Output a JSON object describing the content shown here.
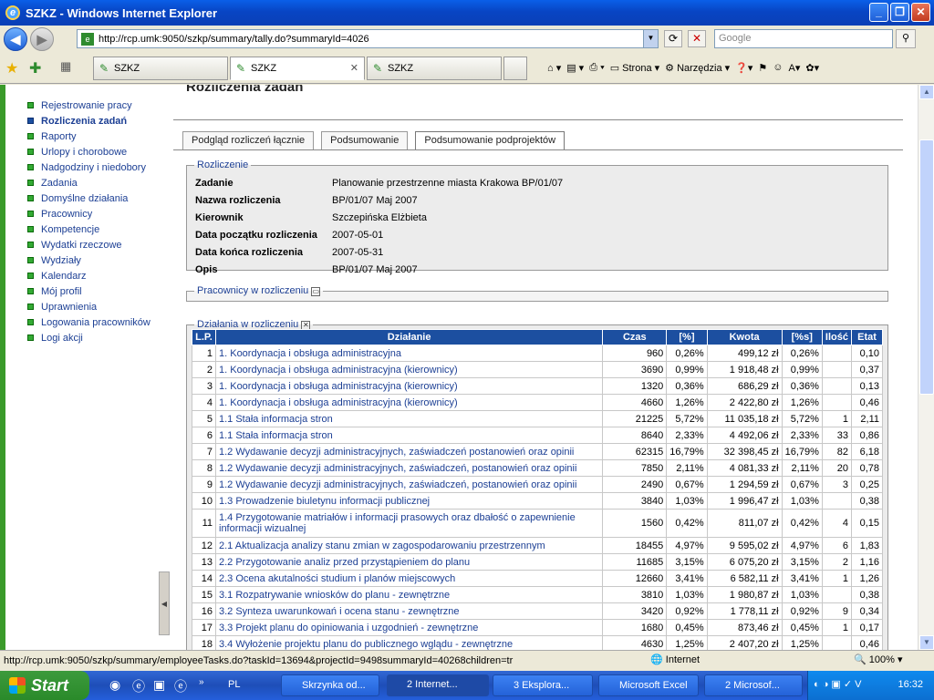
{
  "window": {
    "title": "SZKZ - Windows Internet Explorer"
  },
  "address": {
    "url": "http://rcp.umk:9050/szkp/summary/tally.do?summaryId=4026"
  },
  "search": {
    "placeholder": "Google"
  },
  "browser_tabs": [
    {
      "label": "SZKZ"
    },
    {
      "label": "SZKZ"
    },
    {
      "label": "SZKZ"
    }
  ],
  "toolbar": {
    "page_label": "Strona",
    "tools_label": "Narzędzia"
  },
  "sidebar": {
    "items": [
      {
        "label": "Rejestrowanie pracy"
      },
      {
        "label": "Rozliczenia zadań"
      },
      {
        "label": "Raporty"
      },
      {
        "label": "Urlopy i chorobowe"
      },
      {
        "label": "Nadgodziny i niedobory"
      },
      {
        "label": "Zadania"
      },
      {
        "label": "Domyślne działania"
      },
      {
        "label": "Pracownicy"
      },
      {
        "label": "Kompetencje"
      },
      {
        "label": "Wydatki rzeczowe"
      },
      {
        "label": "Wydziały"
      },
      {
        "label": "Kalendarz"
      },
      {
        "label": "Mój profil"
      },
      {
        "label": "Uprawnienia"
      },
      {
        "label": "Logowania pracowników"
      },
      {
        "label": "Logi akcji"
      }
    ]
  },
  "main": {
    "title": "Rozliczenia zadań",
    "tabs": [
      {
        "label": "Podgląd rozliczeń łącznie"
      },
      {
        "label": "Podsumowanie"
      },
      {
        "label": "Podsumowanie podprojektów"
      }
    ],
    "rozliczenie": {
      "legend": "Rozliczenie",
      "rows": [
        {
          "key": "Zadanie",
          "value": "Planowanie przestrzenne miasta Krakowa BP/01/07"
        },
        {
          "key": "Nazwa rozliczenia",
          "value": "BP/01/07 Maj 2007"
        },
        {
          "key": "Kierownik",
          "value": "Szczepińska Elżbieta"
        },
        {
          "key": "Data początku rozliczenia",
          "value": "2007-05-01"
        },
        {
          "key": "Data końca rozliczenia",
          "value": "2007-05-31"
        },
        {
          "key": "Opis",
          "value": "BP/01/07 Maj 2007"
        }
      ]
    },
    "pracownicy_legend": "Pracownicy w rozliczeniu",
    "dzialania_legend": "Działania w rozliczeniu",
    "table": {
      "headers": [
        "L.P.",
        "Działanie",
        "Czas",
        "[%]",
        "Kwota",
        "[%s]",
        "Ilość",
        "Etat"
      ],
      "rows": [
        [
          "1",
          "1. Koordynacja i obsługa administracyjna",
          "960",
          "0,26%",
          "499,12 zł",
          "0,26%",
          "",
          "0,10"
        ],
        [
          "2",
          "1. Koordynacja i obsługa administracyjna (kierownicy)",
          "3690",
          "0,99%",
          "1 918,48 zł",
          "0,99%",
          "",
          "0,37"
        ],
        [
          "3",
          "1. Koordynacja i obsługa administracyjna (kierownicy)",
          "1320",
          "0,36%",
          "686,29 zł",
          "0,36%",
          "",
          "0,13"
        ],
        [
          "4",
          "1. Koordynacja i obsługa administracyjna (kierownicy)",
          "4660",
          "1,26%",
          "2 422,80 zł",
          "1,26%",
          "",
          "0,46"
        ],
        [
          "5",
          "1.1 Stała informacja stron",
          "21225",
          "5,72%",
          "11 035,18 zł",
          "5,72%",
          "1",
          "2,11"
        ],
        [
          "6",
          "1.1 Stała informacja stron",
          "8640",
          "2,33%",
          "4 492,06 zł",
          "2,33%",
          "33",
          "0,86"
        ],
        [
          "7",
          "1.2 Wydawanie decyzji administracyjnych, zaświadczeń postanowień oraz opinii",
          "62315",
          "16,79%",
          "32 398,45 zł",
          "16,79%",
          "82",
          "6,18"
        ],
        [
          "8",
          "1.2 Wydawanie decyzji administracyjnych, zaświadczeń, postanowień oraz opinii",
          "7850",
          "2,11%",
          "4 081,33 zł",
          "2,11%",
          "20",
          "0,78"
        ],
        [
          "9",
          "1.2 Wydawanie decyzji administracyjnych, zaświadczeń, postanowień oraz opinii",
          "2490",
          "0,67%",
          "1 294,59 zł",
          "0,67%",
          "3",
          "0,25"
        ],
        [
          "10",
          "1.3 Prowadzenie biuletynu informacji publicznej",
          "3840",
          "1,03%",
          "1 996,47 zł",
          "1,03%",
          "",
          "0,38"
        ],
        [
          "11",
          "1.4 Przygotowanie matriałów i informacji prasowych oraz dbałość o zapewnienie informacji wizualnej",
          "1560",
          "0,42%",
          "811,07 zł",
          "0,42%",
          "4",
          "0,15"
        ],
        [
          "12",
          "2.1 Aktualizacja analizy stanu zmian w zagospodarowaniu przestrzennym",
          "18455",
          "4,97%",
          "9 595,02 zł",
          "4,97%",
          "6",
          "1,83"
        ],
        [
          "13",
          "2.2 Przygotowanie analiz przed przystąpieniem do planu",
          "11685",
          "3,15%",
          "6 075,20 zł",
          "3,15%",
          "2",
          "1,16"
        ],
        [
          "14",
          "2.3 Ocena akutalności studium i planów miejscowych",
          "12660",
          "3,41%",
          "6 582,11 zł",
          "3,41%",
          "1",
          "1,26"
        ],
        [
          "15",
          "3.1 Rozpatrywanie wniosków do planu - zewnętrzne",
          "3810",
          "1,03%",
          "1 980,87 zł",
          "1,03%",
          "",
          "0,38"
        ],
        [
          "16",
          "3.2 Synteza uwarunkowań i ocena stanu - zewnętrzne",
          "3420",
          "0,92%",
          "1 778,11 zł",
          "0,92%",
          "9",
          "0,34"
        ],
        [
          "17",
          "3.3 Projekt planu do opiniowania i uzgodnień - zewnętrzne",
          "1680",
          "0,45%",
          "873,46 zł",
          "0,45%",
          "1",
          "0,17"
        ],
        [
          "18",
          "3.4 Wyłożenie projektu planu do publicznego wglądu - zewnętrzne",
          "4630",
          "1,25%",
          "2 407,20 zł",
          "1,25%",
          "",
          "0,46"
        ]
      ]
    }
  },
  "statusbar": {
    "url": "http://rcp.umk:9050/szkp/summary/employeeTasks.do?taskId=13694&projectId=9498summaryId=40268children=tr",
    "zone": "Internet",
    "zoom": "100%"
  },
  "taskbar": {
    "start": "Start",
    "lang": "PL",
    "items": [
      {
        "label": "Skrzynka od..."
      },
      {
        "label": "2 Internet..."
      },
      {
        "label": "3 Eksplora..."
      },
      {
        "label": "Microsoft Excel"
      },
      {
        "label": "2 Microsof..."
      }
    ],
    "clock": "16:32"
  }
}
